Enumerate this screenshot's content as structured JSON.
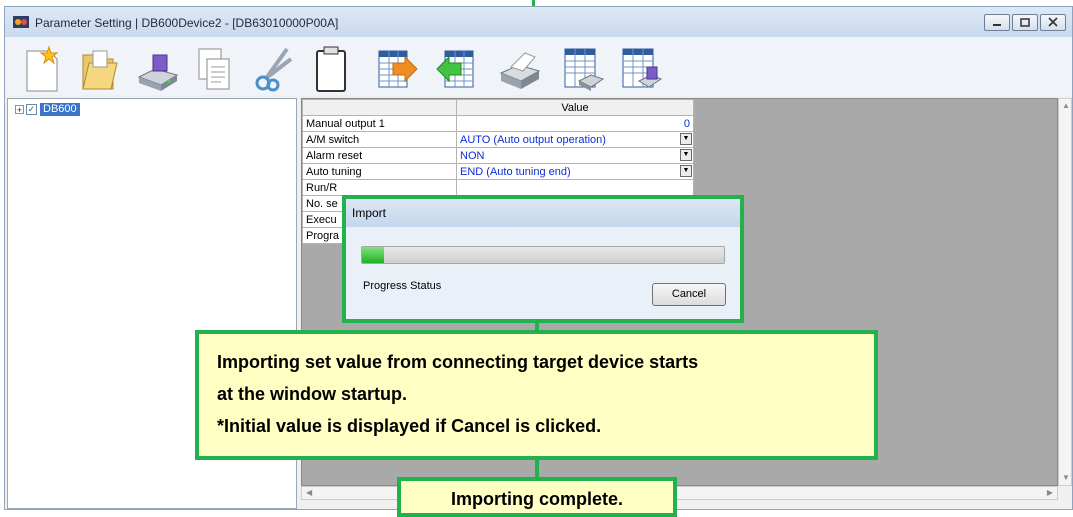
{
  "window": {
    "title": "Parameter Setting | DB600Device2 - [DB63010000P00A]"
  },
  "toolbar": {
    "buttons": [
      {
        "name": "new-icon"
      },
      {
        "name": "open-folder-icon"
      },
      {
        "name": "save-disk-icon"
      },
      {
        "name": "copy-icon"
      },
      {
        "name": "cut-icon"
      },
      {
        "name": "paste-icon"
      },
      {
        "name": "export-icon"
      },
      {
        "name": "import-icon"
      },
      {
        "name": "print-icon"
      },
      {
        "name": "print-preview-icon"
      },
      {
        "name": "save-table-icon"
      }
    ]
  },
  "tree": {
    "expander": "+",
    "check": "✓",
    "root_label": "DB600"
  },
  "grid": {
    "header": "Value",
    "rows": [
      {
        "name": "Manual output 1",
        "value": "0"
      },
      {
        "name": "A/M switch",
        "value": "AUTO (Auto output operation)"
      },
      {
        "name": "Alarm reset",
        "value": "NON"
      },
      {
        "name": "Auto tuning",
        "value": "END (Auto tuning end)"
      },
      {
        "name": "Run/R",
        "value": ""
      },
      {
        "name": "No. se",
        "value": ""
      },
      {
        "name": "Execu",
        "value": ""
      },
      {
        "name": "Progra",
        "value": ""
      }
    ]
  },
  "import_dialog": {
    "title": "Import",
    "progress": 0.06,
    "status_label": "Progress Status",
    "cancel_label": "Cancel"
  },
  "callouts": {
    "line1": "Importing set value from connecting target device starts",
    "line2": "at the window startup.",
    "line3": "*Initial value is displayed if Cancel is clicked.",
    "complete": "Importing complete."
  },
  "colors": {
    "accent_green": "#22b14c",
    "callout_bg": "#ffffc4",
    "value_text": "#0d2dd9"
  }
}
